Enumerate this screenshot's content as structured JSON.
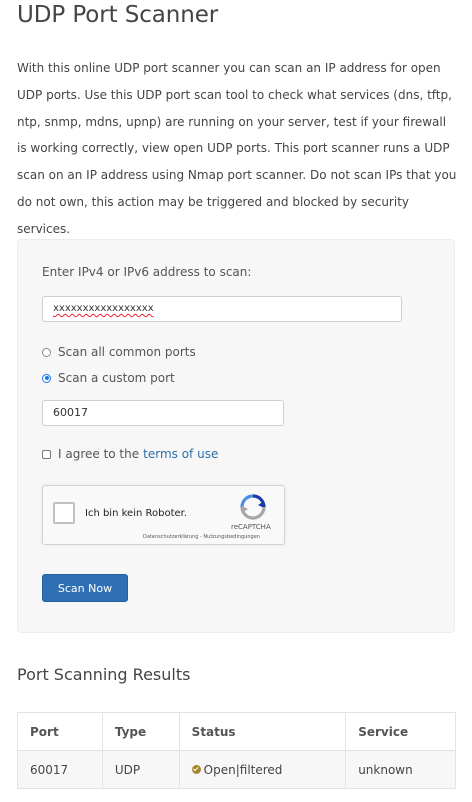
{
  "page": {
    "title": "UDP Port Scanner",
    "intro": "With this online UDP port scanner you can scan an IP address for open UDP ports. Use this UDP port scan tool to check what services (dns, tftp, ntp, snmp, mdns, upnp) are running on your server, test if your firewall is working correctly, view open UDP ports. This port scanner runs a UDP scan on an IP address using Nmap port scanner. Do not scan IPs that you do not own, this action may be triggered and blocked by security services."
  },
  "form": {
    "ip_label": "Enter IPv4 or IPv6 address to scan:",
    "ip_value": "xxxxxxxxxxxxxxxxx",
    "radio_all_label": "Scan all common ports",
    "radio_custom_label": "Scan a custom port",
    "selected_option": "custom",
    "port_value": "60017",
    "agree_text": "I agree to the",
    "terms_link": "terms of use",
    "agree_checked": false,
    "recaptcha": {
      "label": "Ich bin kein Roboter.",
      "brand": "reCAPTCHA",
      "links": "Datenschutzerklärung - Nutzungsbedingungen"
    },
    "scan_button": "Scan Now"
  },
  "results": {
    "title": "Port Scanning Results",
    "headers": [
      "Port",
      "Type",
      "Status",
      "Service"
    ],
    "rows": [
      {
        "port": "60017",
        "type": "UDP",
        "status": "Open|filtered",
        "service": "unknown"
      }
    ]
  },
  "colors": {
    "accent": "#2f70b4",
    "link": "#2a6fa8",
    "status_icon": "#a3862a"
  },
  "icons": {
    "status": "check-circle-icon",
    "recaptcha": "recaptcha-logo-icon"
  }
}
